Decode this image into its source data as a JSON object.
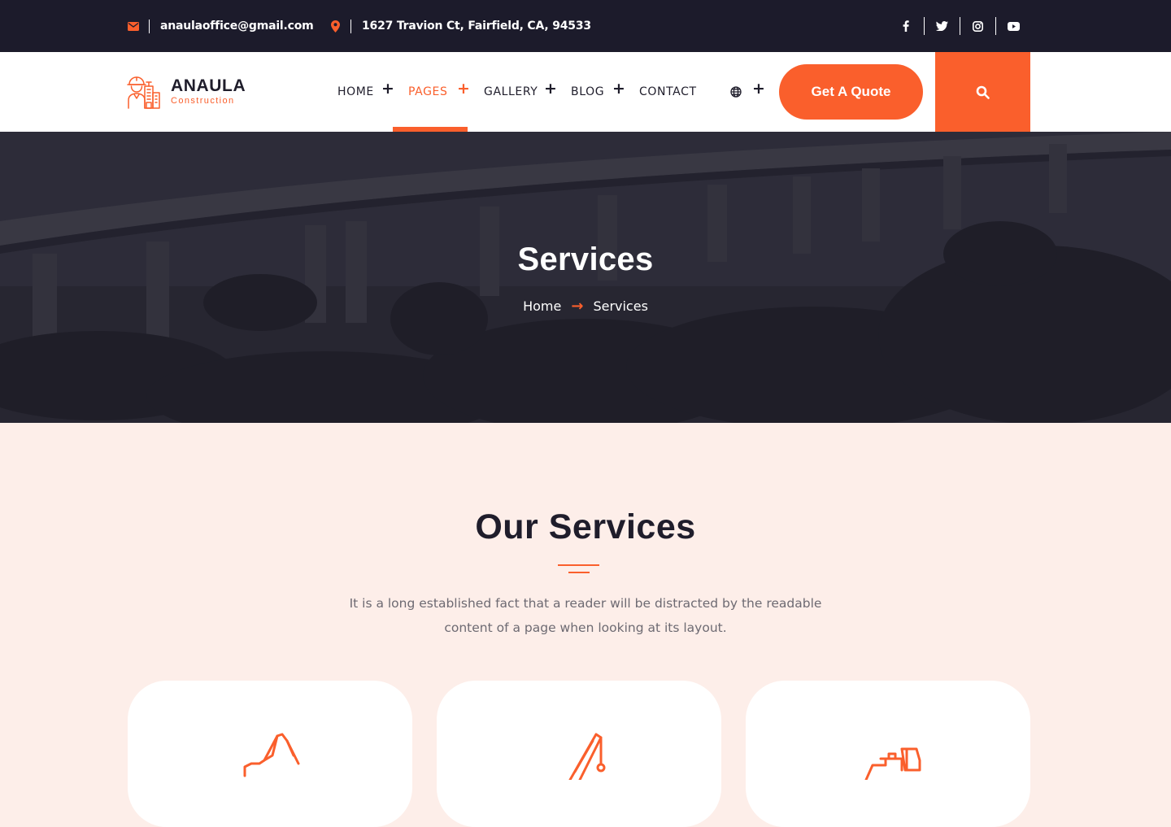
{
  "topbar": {
    "email": "anaulaoffice@gmail.com",
    "address": "1627 Travion Ct, Fairfield, CA, 94533",
    "social": [
      "facebook-icon",
      "twitter-icon",
      "instagram-icon",
      "youtube-icon"
    ]
  },
  "brand": {
    "name": "ANAULA",
    "tagline": "Construction",
    "accent": "#fa5f2c",
    "dark": "#1c1b2b"
  },
  "nav": {
    "items": [
      {
        "label": "HOME"
      },
      {
        "label": "PAGES"
      },
      {
        "label": "GALLERY"
      },
      {
        "label": "BLOG"
      },
      {
        "label": "CONTACT"
      }
    ],
    "active": "PAGES",
    "quote_label": "Get A Quote"
  },
  "hero": {
    "title": "Services",
    "breadcrumb": {
      "home": "Home",
      "current": "Services"
    }
  },
  "services": {
    "title": "Our Services",
    "description": "It is a long established fact that a reader will be distracted by the readable content of a page when looking at its layout.",
    "cards": [
      {
        "icon": "excavator-icon"
      },
      {
        "icon": "crane-icon"
      },
      {
        "icon": "bulldozer-icon"
      }
    ]
  }
}
